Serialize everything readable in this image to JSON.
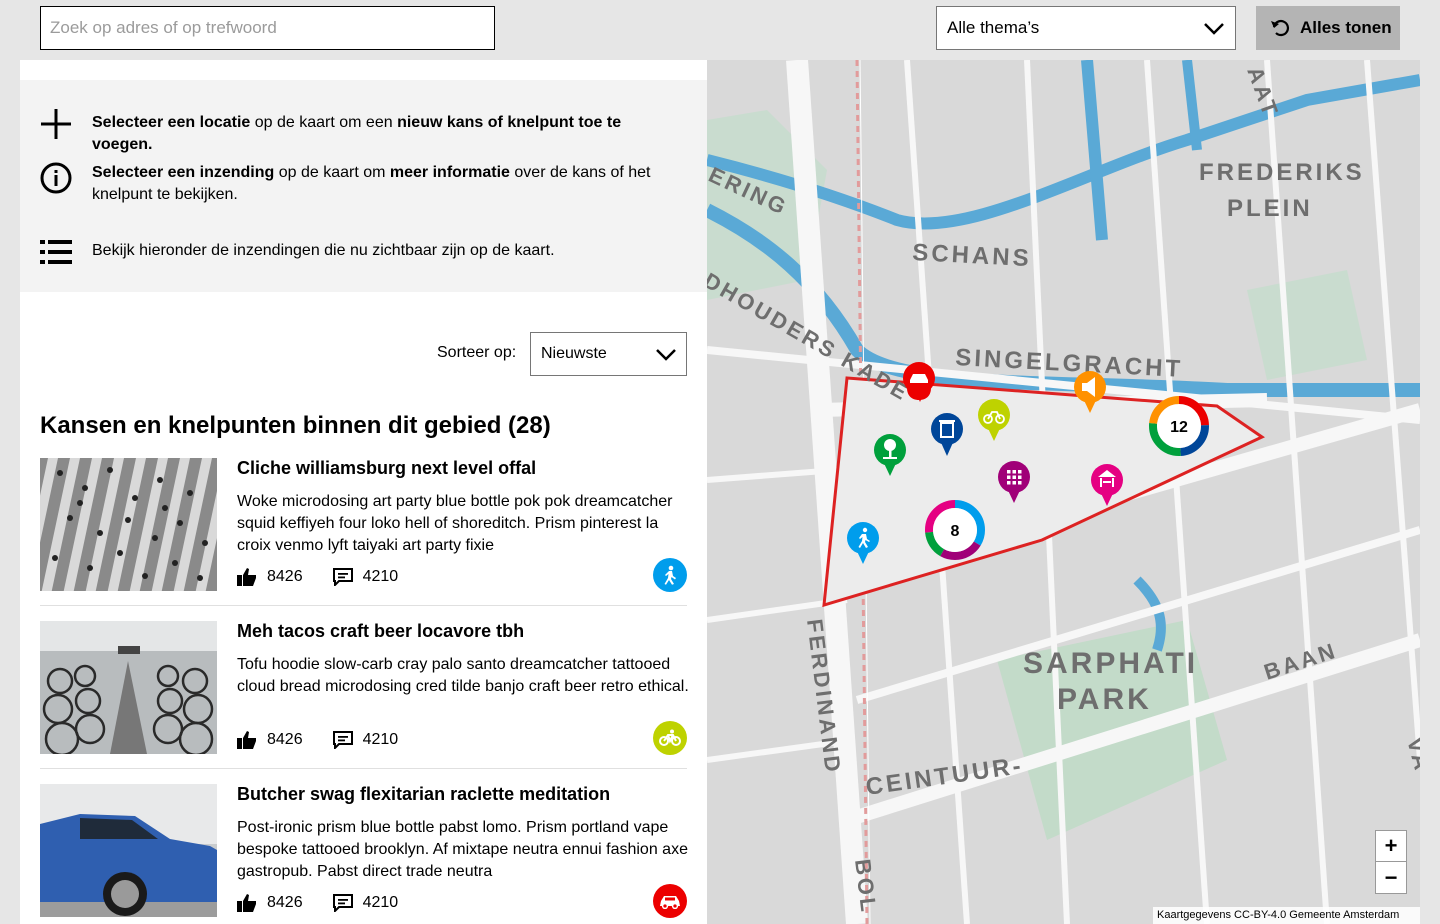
{
  "search": {
    "placeholder": "Zoek op adres of op trefwoord",
    "value": ""
  },
  "theme_filter": {
    "selected": "Alle thema’s"
  },
  "show_all": {
    "label": "Alles tonen"
  },
  "instructions": [
    {
      "icon": "plus-icon",
      "bold1": "Selecteer een locatie",
      "text1": " op de kaart om een ",
      "bold2": "nieuw kans of knelpunt toe te voegen.",
      "text2": ""
    },
    {
      "icon": "info-icon",
      "bold1": "Selecteer een inzending",
      "text1": " op de kaart om ",
      "bold2": "meer informatie",
      "text2": " over de kans of het knelpunt te bekijken."
    },
    {
      "icon": "list-icon",
      "bold1": "",
      "text1": "Bekijk hieronder de inzendingen die nu zichtbaar zijn op de kaart.",
      "bold2": "",
      "text2": ""
    }
  ],
  "sort": {
    "label": "Sorteer op:",
    "selected": "Nieuwste"
  },
  "list": {
    "title": "Kansen en knelpunten binnen dit gebied (28)",
    "items": [
      {
        "title": "Cliche williamsburg next level offal",
        "description": "Woke microdosing art party blue bottle pok pok dreamcatcher squid keffiyeh four loko hell of shoreditch. Prism pinterest la croix venmo lyft taiyaki art party fixie",
        "likes": "8426",
        "comments": "4210",
        "theme_icon": "pedestrian-icon",
        "theme_color": "#009dec"
      },
      {
        "title": "Meh tacos craft beer locavore tbh",
        "description": "Tofu hoodie slow-carb cray palo santo dreamcatcher tattooed cloud bread microdosing cred tilde banjo craft beer retro ethical.",
        "likes": "8426",
        "comments": "4210",
        "theme_icon": "bicycle-icon",
        "theme_color": "#bed200"
      },
      {
        "title": "Butcher swag flexitarian raclette meditation",
        "description": "Post-ironic prism blue bottle pabst lomo. Prism portland vape bespoke tattooed brooklyn. Af mixtape neutra ennui fashion axe gastropub. Pabst direct trade neutra",
        "likes": "8426",
        "comments": "4210",
        "theme_icon": "car-icon",
        "theme_color": "#ec0000"
      }
    ]
  },
  "map": {
    "labels": [
      "FREDERIKS",
      "PLEIN",
      "SCHANS",
      "SINGELGRACHT",
      "SARPHATI",
      "PARK",
      "BAAN",
      "CEINTUUR-",
      "FERDINAND",
      "BOL",
      "AAT",
      "ERING",
      "DHOUDERS KADE",
      "VA"
    ],
    "clusters": [
      {
        "count": "12"
      },
      {
        "count": "8"
      }
    ],
    "markers": [
      "car-icon",
      "trash-icon",
      "bicycle-icon",
      "noise-icon",
      "tree-icon",
      "grid-icon",
      "playground-icon",
      "pedestrian-icon"
    ],
    "zoom_in": "+",
    "zoom_out": "−",
    "attribution": "Kaartgegevens CC-BY-4.0 Gemeente Amsterdam"
  },
  "colors": {
    "accent_red": "#ec0000",
    "blue": "#009dec",
    "green": "#00a03c",
    "lime": "#bed200",
    "orange": "#ff9100",
    "magenta": "#e50082",
    "purple": "#a00078",
    "darkblue": "#004699"
  }
}
